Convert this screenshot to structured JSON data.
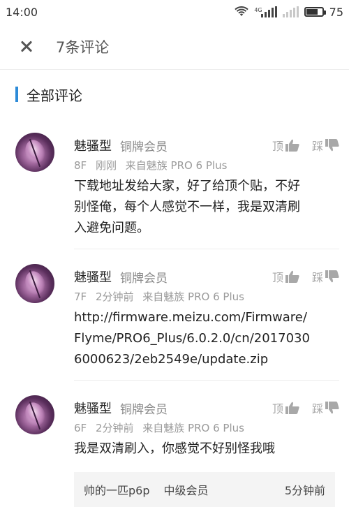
{
  "status_bar": {
    "time": "14:00",
    "network_label": "4G",
    "battery": "75",
    "battery_level": 0.75
  },
  "header": {
    "title": "7条评论"
  },
  "section": {
    "title": "全部评论"
  },
  "comments": [
    {
      "username": "魅骚型",
      "level": "铜牌会员",
      "like_label": "顶",
      "dislike_label": "踩",
      "floor": "8F",
      "time": "刚刚",
      "device": "来自魅族 PRO 6 Plus",
      "text": "下载地址发给大家，好了给顶个贴，不好别怪俺，每个人感觉不一样，我是双清刷入避免问题。"
    },
    {
      "username": "魅骚型",
      "level": "铜牌会员",
      "like_label": "顶",
      "dislike_label": "踩",
      "floor": "7F",
      "time": "2分钟前",
      "device": "来自魅族 PRO 6 Plus",
      "text": "http://firmware.meizu.com/Firmware/Flyme/PRO6_Plus/6.0.2.0/cn/20170306000623/2eb2549e/update.zip"
    },
    {
      "username": "魅骚型",
      "level": "铜牌会员",
      "like_label": "顶",
      "dislike_label": "踩",
      "floor": "6F",
      "time": "2分钟前",
      "device": "来自魅族 PRO 6 Plus",
      "text": "我是双清刷入，你感觉不好别怪我哦"
    }
  ],
  "reply_preview": {
    "username": "帅的一匹p6p",
    "level": "中级会员",
    "time": "5分钟前"
  },
  "colors": {
    "accent": "#2d8bd8"
  }
}
